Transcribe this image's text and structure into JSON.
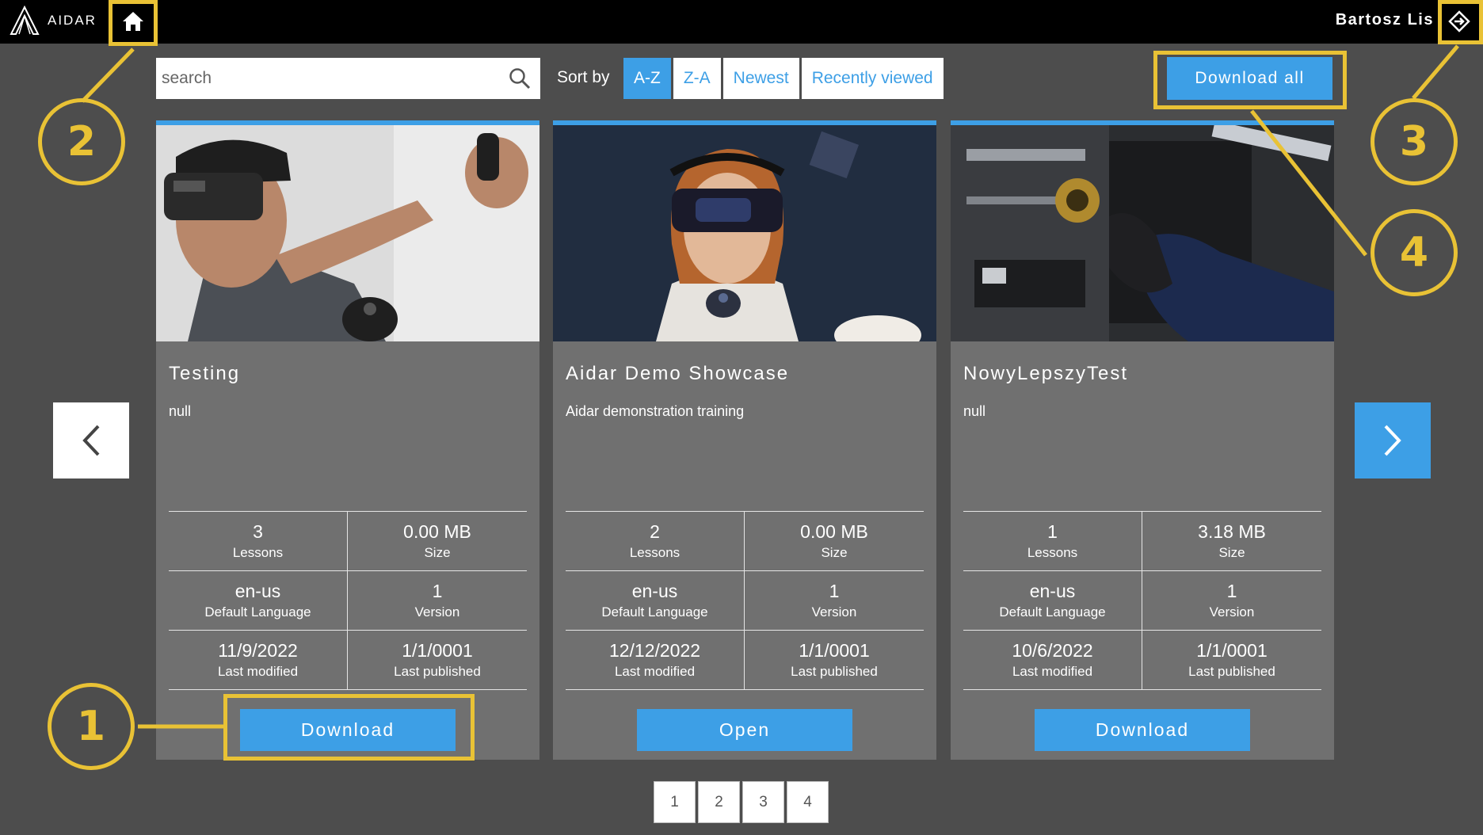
{
  "brand": {
    "name": "AIDAR"
  },
  "user": {
    "name": "Bartosz Lis"
  },
  "toolbar": {
    "search_placeholder": "search",
    "sort_label": "Sort by",
    "sort_options": [
      {
        "label": "A-Z",
        "active": true
      },
      {
        "label": "Z-A",
        "active": false
      },
      {
        "label": "Newest",
        "active": false
      },
      {
        "label": "Recently viewed",
        "active": false
      }
    ],
    "download_all_label": "Download all"
  },
  "labels": {
    "lessons": "Lessons",
    "size": "Size",
    "default_language": "Default Language",
    "version": "Version",
    "last_modified": "Last modified",
    "last_published": "Last published"
  },
  "cards": [
    {
      "title": "Testing",
      "description": "null",
      "lessons": "3",
      "size": "0.00 MB",
      "language": "en-us",
      "version": "1",
      "last_modified": "11/9/2022",
      "last_published": "1/1/0001",
      "action": "Download"
    },
    {
      "title": "Aidar Demo Showcase",
      "description": "Aidar demonstration training",
      "lessons": "2",
      "size": "0.00 MB",
      "language": "en-us",
      "version": "1",
      "last_modified": "12/12/2022",
      "last_published": "1/1/0001",
      "action": "Open"
    },
    {
      "title": "NowyLepszyTest",
      "description": "null",
      "lessons": "1",
      "size": "3.18 MB",
      "language": "en-us",
      "version": "1",
      "last_modified": "10/6/2022",
      "last_published": "1/1/0001",
      "action": "Download"
    }
  ],
  "pagination": {
    "pages": [
      "1",
      "2",
      "3",
      "4"
    ]
  },
  "annotations": {
    "callouts": [
      "1",
      "2",
      "3",
      "4"
    ],
    "color": "#e9c235"
  },
  "colors": {
    "accent": "#3d9fe6",
    "background": "#4d4d4d",
    "card": "#707070",
    "topbar": "#000000"
  }
}
